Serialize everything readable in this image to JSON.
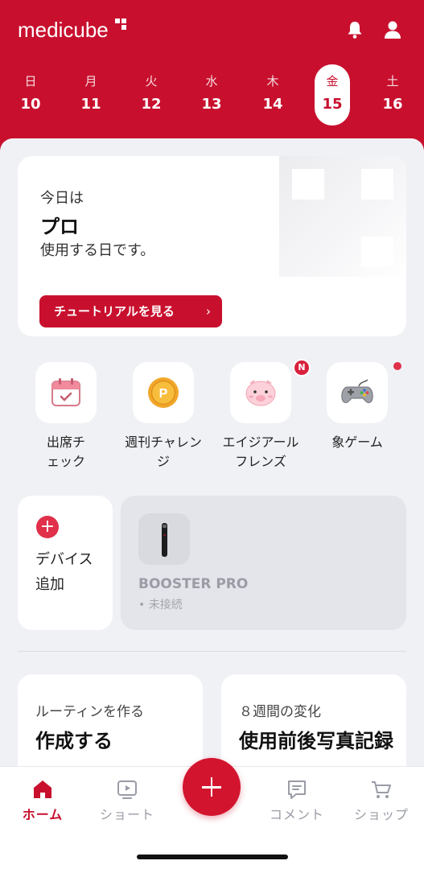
{
  "app": {
    "logo": "medicube"
  },
  "calendar": {
    "days": [
      {
        "weekday": "日",
        "date": "10"
      },
      {
        "weekday": "月",
        "date": "11"
      },
      {
        "weekday": "火",
        "date": "12"
      },
      {
        "weekday": "水",
        "date": "13"
      },
      {
        "weekday": "木",
        "date": "14"
      },
      {
        "weekday": "金",
        "date": "15",
        "selected": true
      },
      {
        "weekday": "土",
        "date": "16"
      }
    ]
  },
  "hero": {
    "line1": "今日は",
    "line2": "プロ",
    "line3": "使用する日です。",
    "button_label": "チュートリアルを見る",
    "button_chevron": "›"
  },
  "quick_actions": [
    {
      "label": "出席チェック",
      "icon": "calendar-check-icon"
    },
    {
      "label": "週刊チャレンジ",
      "icon": "coin-icon"
    },
    {
      "label": "エイジアールフレンズ",
      "icon": "pig-icon",
      "badge": "N"
    },
    {
      "label": "象ゲーム",
      "icon": "gamepad-icon",
      "dot": true
    }
  ],
  "device": {
    "add_label": "デバイス追加",
    "add_icon": "plus-icon",
    "name": "BOOSTER PRO",
    "status": "未接続"
  },
  "cards": [
    {
      "subtitle": "ルーティンを作る",
      "title": "作成する"
    },
    {
      "subtitle": "８週間の変化",
      "title": "使用前後写真記録"
    }
  ],
  "nav": {
    "items": [
      {
        "label": "ホーム",
        "icon": "home-icon",
        "active": true
      },
      {
        "label": "ショート",
        "icon": "video-icon"
      },
      {
        "label": "コメント",
        "icon": "comment-icon"
      },
      {
        "label": "ショップ",
        "icon": "cart-icon"
      }
    ],
    "fab_icon": "plus-icon"
  },
  "colors": {
    "brand": "#c8102e",
    "background": "#f0f1f5"
  }
}
